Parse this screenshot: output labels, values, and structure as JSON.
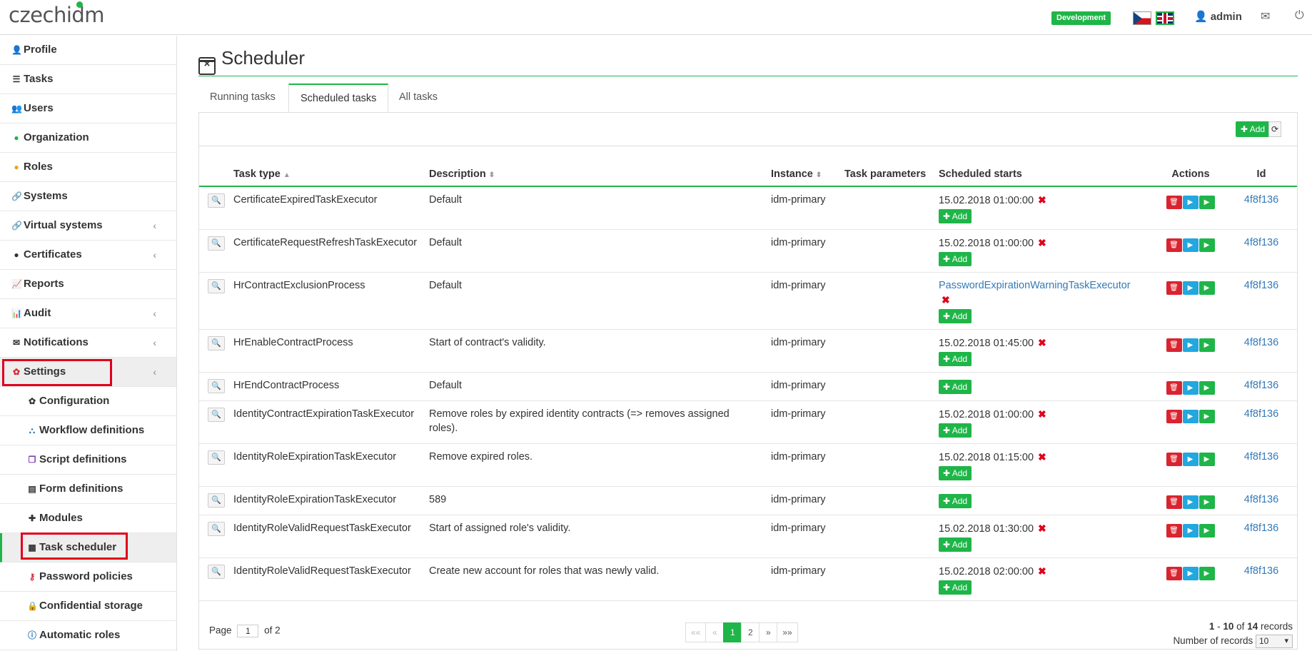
{
  "app": {
    "logo_text": "czechidm",
    "logo_part1": "czech",
    "logo_part2": "idm",
    "environment": "Development",
    "username": "admin"
  },
  "colors": {
    "brand": "#1fb548",
    "danger": "#d9242f",
    "info": "#22a7de",
    "link": "#337ab7",
    "highlight": "#e0001b"
  },
  "sidebar": {
    "items": [
      {
        "label": "Profile",
        "icon": "user-icon"
      },
      {
        "label": "Tasks",
        "icon": "tasks-icon"
      },
      {
        "label": "Users",
        "icon": "users-icon"
      },
      {
        "label": "Organization",
        "icon": "tree-icon"
      },
      {
        "label": "Roles",
        "icon": "role-icon"
      },
      {
        "label": "Systems",
        "icon": "link-icon"
      },
      {
        "label": "Virtual systems",
        "icon": "link-icon"
      },
      {
        "label": "Certificates",
        "icon": "certificate-icon"
      },
      {
        "label": "Reports",
        "icon": "line-chart-icon"
      },
      {
        "label": "Audit",
        "icon": "bar-chart-icon"
      },
      {
        "label": "Notifications",
        "icon": "envelope-icon"
      },
      {
        "label": "Settings",
        "icon": "cog-icon"
      }
    ],
    "settings_items": [
      {
        "label": "Configuration",
        "icon": "cog-icon"
      },
      {
        "label": "Workflow definitions",
        "icon": "sitemap-icon"
      },
      {
        "label": "Script definitions",
        "icon": "copy-icon"
      },
      {
        "label": "Form definitions",
        "icon": "form-icon"
      },
      {
        "label": "Modules",
        "icon": "puzzle-icon"
      },
      {
        "label": "Task scheduler",
        "icon": "calendar-icon"
      },
      {
        "label": "Password policies",
        "icon": "key-icon"
      },
      {
        "label": "Confidential storage",
        "icon": "lock-icon"
      },
      {
        "label": "Automatic roles",
        "icon": "info-icon"
      }
    ]
  },
  "page": {
    "title": "Scheduler"
  },
  "tabs": [
    "Running tasks",
    "Scheduled tasks",
    "All tasks"
  ],
  "toolbar": {
    "add_label": "Add"
  },
  "table": {
    "columns": [
      "Task type",
      "Description",
      "Instance",
      "Task parameters",
      "Scheduled starts",
      "Actions",
      "Id"
    ],
    "add_label": "Add",
    "rows": [
      {
        "task_type": "CertificateExpiredTaskExecutor",
        "description": "Default",
        "instance": "idm-primary",
        "start": "15.02.2018 01:00:00",
        "id": "4f8f136"
      },
      {
        "task_type": "CertificateRequestRefreshTaskExecutor",
        "description": "Default",
        "instance": "idm-primary",
        "start": "15.02.2018 01:00:00",
        "id": "4f8f136"
      },
      {
        "task_type": "HrContractExclusionProcess",
        "description": "Default",
        "instance": "idm-primary",
        "start": "PasswordExpirationWarningTaskExecutor",
        "id": "4f8f136"
      },
      {
        "task_type": "HrEnableContractProcess",
        "description": "Start of contract's validity.",
        "instance": "idm-primary",
        "start": "15.02.2018 01:45:00",
        "id": "4f8f136"
      },
      {
        "task_type": "HrEndContractProcess",
        "description": "Default",
        "instance": "idm-primary",
        "start": "",
        "id": "4f8f136"
      },
      {
        "task_type": "IdentityContractExpirationTaskExecutor",
        "description": "Remove roles by expired identity contracts (=> removes assigned roles).",
        "instance": "idm-primary",
        "start": "15.02.2018 01:00:00",
        "id": "4f8f136"
      },
      {
        "task_type": "IdentityRoleExpirationTaskExecutor",
        "description": "Remove expired roles.",
        "instance": "idm-primary",
        "start": "15.02.2018 01:15:00",
        "id": "4f8f136"
      },
      {
        "task_type": "IdentityRoleExpirationTaskExecutor",
        "description": "589",
        "instance": "idm-primary",
        "start": "",
        "id": "4f8f136"
      },
      {
        "task_type": "IdentityRoleValidRequestTaskExecutor",
        "description": "Start of assigned role's validity.",
        "instance": "idm-primary",
        "start": "15.02.2018 01:30:00",
        "id": "4f8f136"
      },
      {
        "task_type": "IdentityRoleValidRequestTaskExecutor",
        "description": "Create new account for roles that was newly valid.",
        "instance": "idm-primary",
        "start": "15.02.2018 02:00:00",
        "id": "4f8f136"
      }
    ]
  },
  "pager": {
    "page_label": "Page",
    "page_value": "1",
    "of_label": "of 2",
    "buttons": [
      "««",
      "«",
      "1",
      "2",
      "»",
      "»»"
    ],
    "range_from": "1",
    "range_sep": " - ",
    "range_to": "10",
    "of_word": " of ",
    "total": "14",
    "records_word": " records",
    "records_label": "Number of records",
    "records_value": "10"
  }
}
